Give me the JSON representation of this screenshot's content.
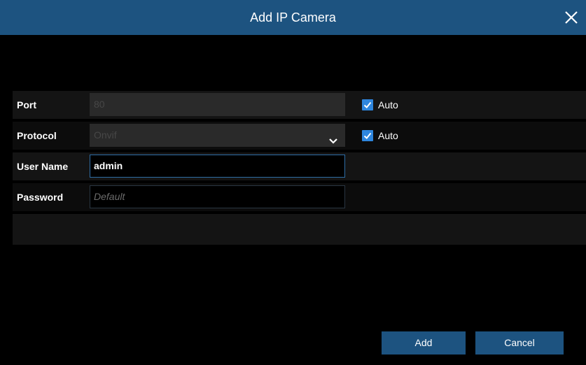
{
  "dialog": {
    "title": "Add IP Camera",
    "close_icon": "close-icon"
  },
  "form": {
    "port": {
      "label": "Port",
      "value": "80",
      "auto_label": "Auto",
      "auto_checked": true
    },
    "protocol": {
      "label": "Protocol",
      "value": "Onvif",
      "auto_label": "Auto",
      "auto_checked": true
    },
    "user_name": {
      "label": "User Name",
      "value": "admin"
    },
    "password": {
      "label": "Password",
      "placeholder": "Default"
    }
  },
  "buttons": {
    "add": "Add",
    "cancel": "Cancel"
  },
  "colors": {
    "title_bar": "#1d5380",
    "accent": "#2e86de",
    "background": "#000000"
  }
}
